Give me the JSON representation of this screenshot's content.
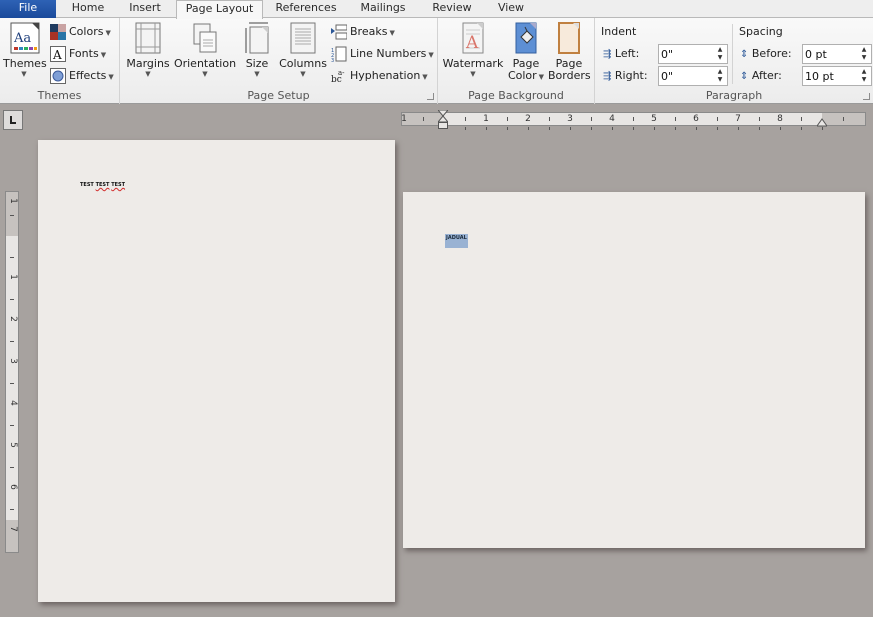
{
  "tabs": [
    {
      "label": "File"
    },
    {
      "label": "Home"
    },
    {
      "label": "Insert"
    },
    {
      "label": "Page Layout",
      "active": true
    },
    {
      "label": "References"
    },
    {
      "label": "Mailings"
    },
    {
      "label": "Review"
    },
    {
      "label": "View"
    }
  ],
  "ribbon": {
    "themes": {
      "group_label": "Themes",
      "themes_button": "Themes",
      "colors": "Colors",
      "fonts": "Fonts",
      "effects": "Effects"
    },
    "page_setup": {
      "group_label": "Page Setup",
      "margins": "Margins",
      "orientation": "Orientation",
      "size": "Size",
      "columns": "Columns",
      "breaks": "Breaks",
      "line_numbers": "Line Numbers",
      "hyphenation": "Hyphenation"
    },
    "page_background": {
      "group_label": "Page Background",
      "watermark": "Watermark",
      "page_color_line1": "Page",
      "page_color_line2": "Color",
      "page_borders_line1": "Page",
      "page_borders_line2": "Borders"
    },
    "paragraph": {
      "group_label": "Paragraph",
      "indent_title": "Indent",
      "left_label": "Left:",
      "left_value": "0\"",
      "right_label": "Right:",
      "right_value": "0\"",
      "spacing_title": "Spacing",
      "before_label": "Before:",
      "before_value": "0 pt",
      "after_label": "After:",
      "after_value": "10 pt"
    }
  },
  "rulers": {
    "horizontal_numbers": [
      "1",
      "1",
      "2",
      "3",
      "4",
      "5",
      "6",
      "7",
      "8"
    ],
    "vertical_numbers": [
      "1",
      "1",
      "2",
      "3",
      "4",
      "5",
      "6",
      "7"
    ]
  },
  "document": {
    "page1": {
      "word1": "TEST",
      "word2": "TEST",
      "word3": "TEST"
    },
    "page2": {
      "selected_text": "JADUAL"
    }
  },
  "colors": {
    "file_tab": "#2a5db0",
    "selection": "#99b2d3",
    "workspace": "#a7a29f",
    "page": "#eeebe8"
  }
}
